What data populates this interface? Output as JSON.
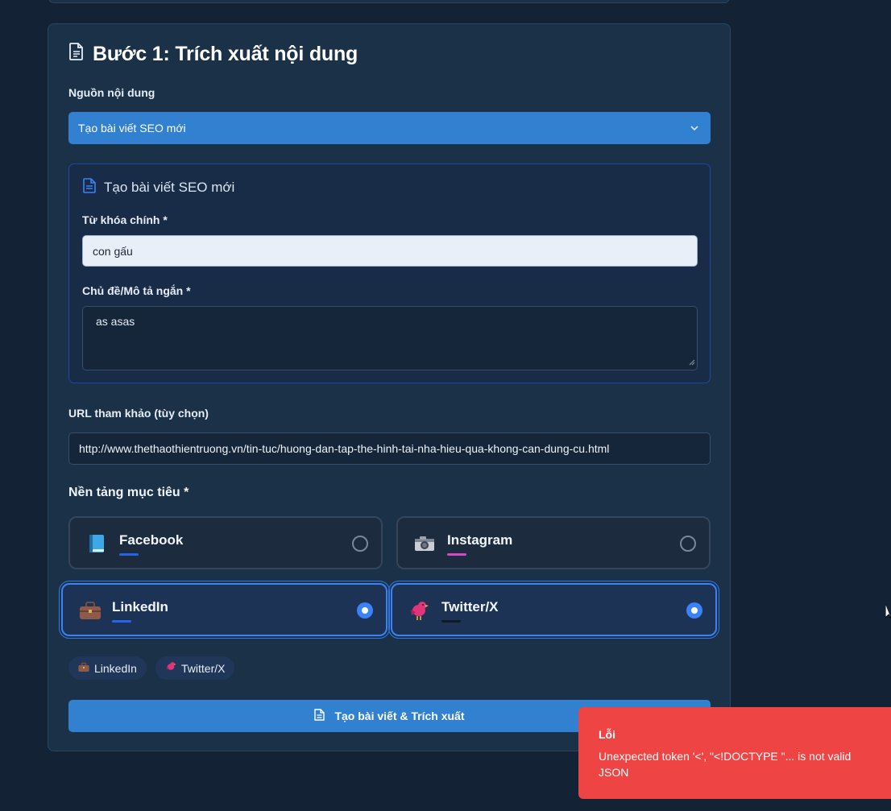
{
  "step": {
    "title": "Bước 1: Trích xuất nội dung",
    "source_label": "Nguồn nội dung",
    "source_selected": "Tạo bài viết SEO mới"
  },
  "seo_panel": {
    "title": "Tạo bài viết SEO mới",
    "keyword_label": "Từ khóa chính *",
    "keyword_value": "con gấu",
    "topic_label": "Chủ đề/Mô tả ngắn *",
    "topic_value": "as asas"
  },
  "reference": {
    "label": "URL tham khảo (tùy chọn)",
    "value": "http://www.thethaothientruong.vn/tin-tuc/huong-dan-tap-the-hinh-tai-nha-hieu-qua-khong-can-dung-cu.html"
  },
  "platforms": {
    "label": "Nền tảng mục tiêu *",
    "items": [
      {
        "name": "Facebook",
        "icon": "book-icon",
        "selected": false,
        "accent": "#2563eb"
      },
      {
        "name": "Instagram",
        "icon": "camera-icon",
        "selected": false,
        "accent": "#d946c7"
      },
      {
        "name": "LinkedIn",
        "icon": "briefcase-icon",
        "selected": true,
        "accent": "#2563eb"
      },
      {
        "name": "Twitter/X",
        "icon": "bird-icon",
        "selected": true,
        "accent": "#111827"
      }
    ],
    "selected_chips": [
      "LinkedIn",
      "Twitter/X"
    ]
  },
  "submit_label": "Tạo bài viết & Trích xuất",
  "toast": {
    "title": "Lỗi",
    "message": "Unexpected token '<', \"<!DOCTYPE \"... is not valid JSON"
  },
  "colors": {
    "accent": "#3181d0",
    "selected_border": "#3b82f6",
    "error": "#ef4444"
  }
}
